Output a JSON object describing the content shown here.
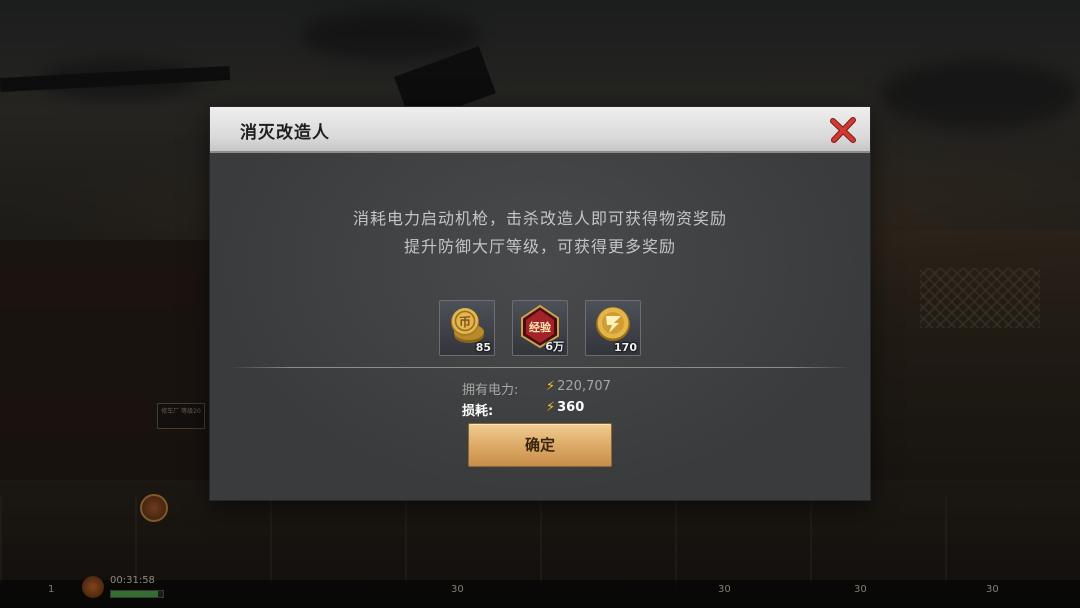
{
  "dialog": {
    "title": "消灭改造人",
    "description_line1": "消耗电力启动机枪，击杀改造人即可获得物资奖励",
    "description_line2": "提升防御大厅等级，可获得更多奖励",
    "rewards": [
      {
        "icon": "coin-icon",
        "count": "85"
      },
      {
        "icon": "experience-badge-icon",
        "label": "经验",
        "count": "6万"
      },
      {
        "icon": "gold-token-icon",
        "count": "170"
      }
    ],
    "power_owned_label": "拥有电力:",
    "power_owned_value": "220,707",
    "cost_label": "损耗:",
    "cost_value": "360",
    "confirm_label": "确定",
    "close_icon": "close-x-icon"
  },
  "background": {
    "timer": "00:31:58",
    "timer_progress": 0.9,
    "floor_numbers": [
      "1",
      "30",
      "30",
      "30",
      "30"
    ],
    "sign_text": "修车厂 等级20"
  },
  "colors": {
    "dialog_bg": "#3a3b3c",
    "header_bg": "#e3e3e3",
    "close_red": "#c4322c",
    "button_gold": "#dca865",
    "power_bolt": "#f5c52c"
  }
}
